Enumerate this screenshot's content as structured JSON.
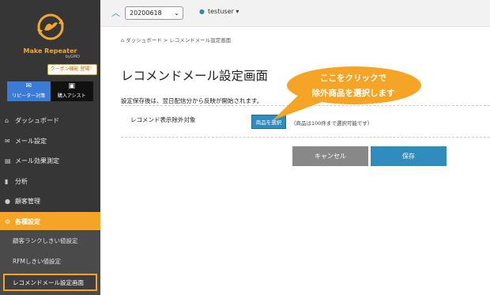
{
  "sidebar": {
    "logo_text": "Make Repeater",
    "logo_sub": "byGMO",
    "coupon_badge": "クーポン機能 登場！",
    "apps": [
      {
        "label": "リピーター対策",
        "icon": "mail-icon"
      },
      {
        "label": "購入アシスト",
        "icon": "cart-icon"
      }
    ],
    "nav": [
      {
        "label": "ダッシュボード",
        "icon": "home-icon"
      },
      {
        "label": "メール設定",
        "icon": "mail-icon"
      },
      {
        "label": "メール効果測定",
        "icon": "chart-icon"
      },
      {
        "label": "分析",
        "icon": "bar-chart-icon"
      },
      {
        "label": "顧客管理",
        "icon": "user-icon"
      },
      {
        "label": "各種設定",
        "icon": "settings-icon"
      }
    ],
    "sub": [
      {
        "label": "顧客ランクしきい値設定"
      },
      {
        "label": "RFMしきい値設定"
      },
      {
        "label": "レコメンドメール設定画面"
      }
    ]
  },
  "topbar": {
    "date_value": "20200618",
    "user": "testuser ▾"
  },
  "breadcrumb": "ダッシュボード > レコメンドメール設定画面",
  "page_title": "レコメンドメール設定画面",
  "notice": "設定保存後は、翌日配信分から反映が開始されます。",
  "row": {
    "label": "レコメンド表示除外対象",
    "button": "商品を選択",
    "note": "（商品は100件まで選択可能です）"
  },
  "buttons": {
    "cancel": "キャンセル",
    "save": "保存"
  },
  "callout": {
    "line1": "ここをクリックで",
    "line2": "除外商品を選択します"
  },
  "colors": {
    "accent": "#f5a425",
    "primary": "#2f8cbc",
    "sidebar": "#363636"
  }
}
